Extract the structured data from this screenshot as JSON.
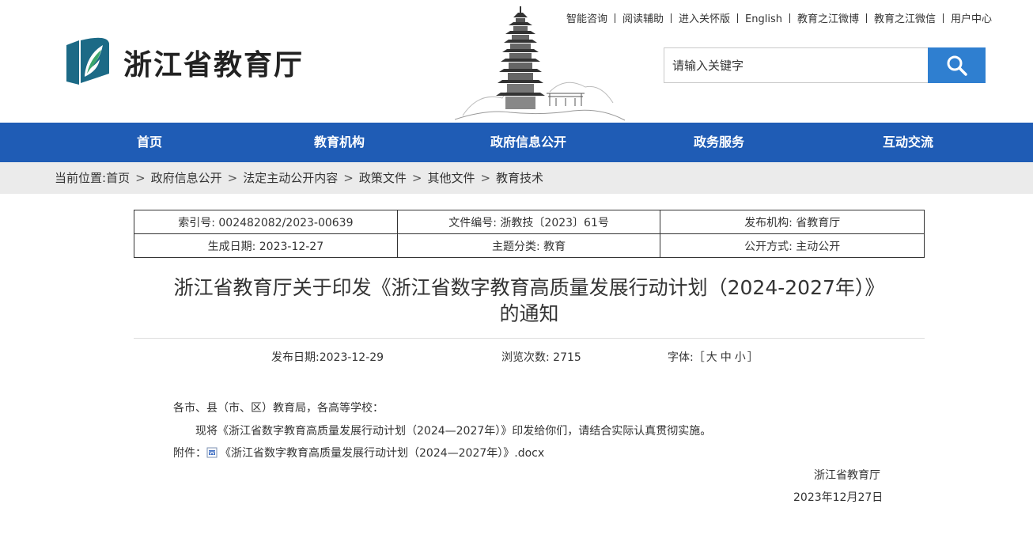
{
  "topbar": {
    "links": [
      "智能咨询",
      "阅读辅助",
      "进入关怀版",
      "English",
      "教育之江微博",
      "教育之江微信",
      "用户中心"
    ]
  },
  "header": {
    "site_name": "浙江省教育厅"
  },
  "search": {
    "placeholder": "请输入关键字"
  },
  "nav": {
    "items": [
      "首页",
      "教育机构",
      "政府信息公开",
      "政务服务",
      "互动交流"
    ]
  },
  "breadcrumb": {
    "prefix": "当前位置:",
    "items": [
      "首页",
      "政府信息公开",
      "法定主动公开内容",
      "政策文件",
      "其他文件",
      "教育技术"
    ],
    "separator": ">"
  },
  "info": {
    "index_no": "索引号: 002482082/2023-00639",
    "doc_no": "文件编号: 浙教技〔2023〕61号",
    "publisher": "发布机构: 省教育厅",
    "created": "生成日期: 2023-12-27",
    "category": "主题分类: 教育",
    "open_mode": "公开方式: 主动公开"
  },
  "article": {
    "title_line1": "浙江省教育厅关于印发《浙江省数字教育高质量发展行动计划（2024-2027年）》",
    "title_line2": "的通知",
    "publish_date": "发布日期:2023-12-29",
    "views": "浏览次数: 2715",
    "font_label": "字体:［",
    "font_large": "大",
    "font_medium": "中",
    "font_small": "小",
    "font_close": "］",
    "salutation": "各市、县（市、区）教育局，各高等学校：",
    "paragraph": "现将《浙江省数字教育高质量发展行动计划（2024—2027年）》印发给你们，请结合实际认真贯彻实施。",
    "attachment_label": "附件：",
    "attachment_name": "《浙江省数字教育高质量发展行动计划（2024—2027年）》.docx",
    "signature": "浙江省教育厅",
    "sign_date": "2023年12月27日"
  },
  "colors": {
    "nav_blue": "#1f5cb5",
    "search_blue": "#2f7fd0",
    "logo_teal": "#1c6a86",
    "logo_green": "#3aa66b",
    "breadcrumb_bg": "#ebebeb"
  }
}
